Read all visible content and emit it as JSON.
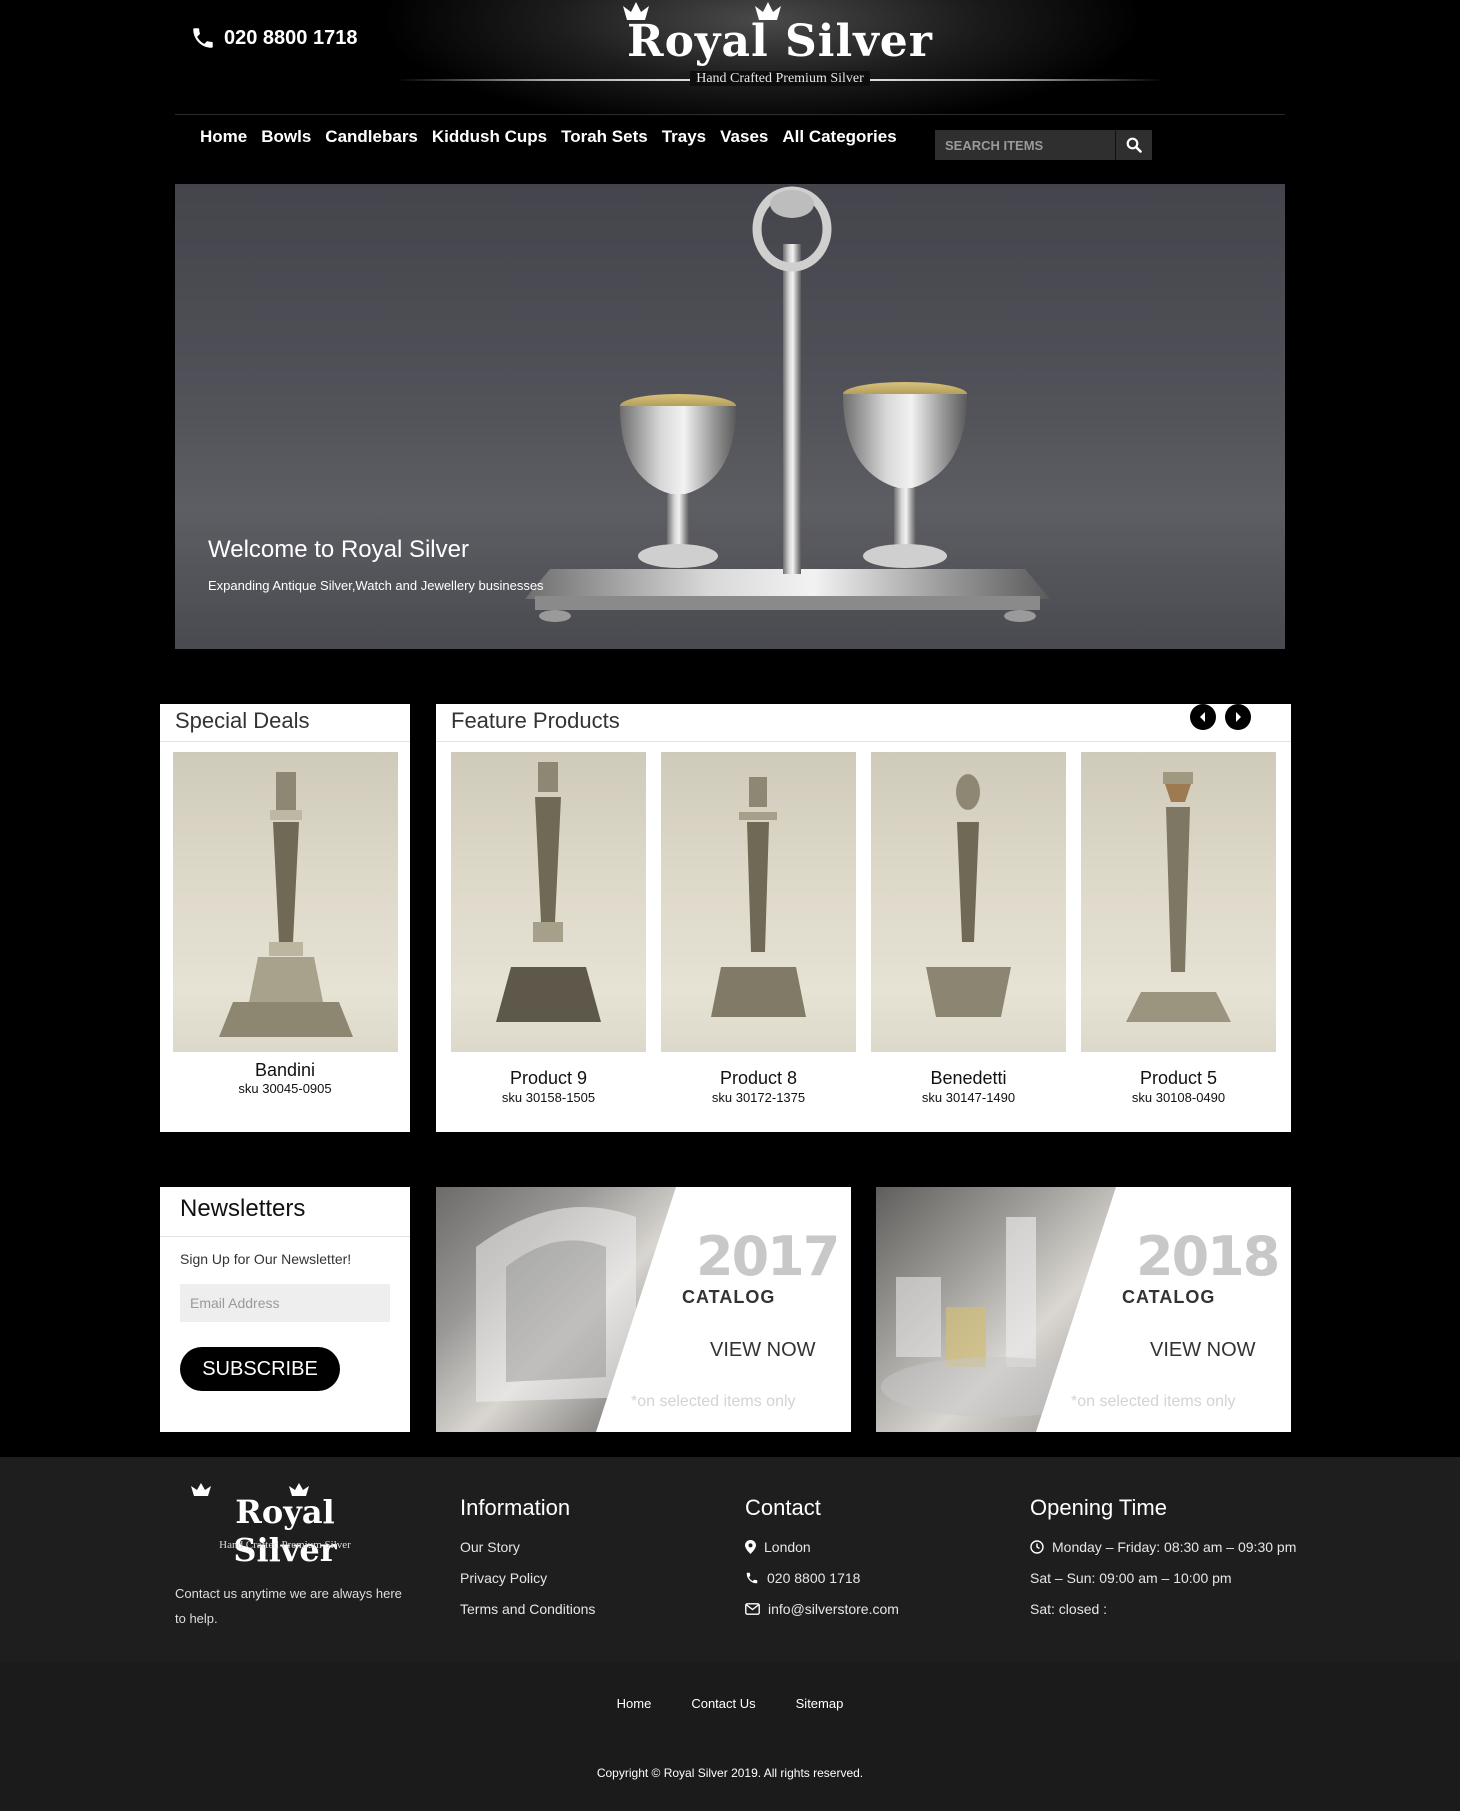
{
  "header": {
    "phone": "020 8800 1718",
    "logo_title": "Royal Silver",
    "logo_subtitle": "Hand Crafted Premium Silver"
  },
  "nav": {
    "items": [
      "Home",
      "Bowls",
      "Candlebars",
      "Kiddush Cups",
      "Torah Sets",
      "Trays",
      "Vases",
      "All Categories"
    ]
  },
  "search": {
    "placeholder": "SEARCH ITEMS"
  },
  "hero": {
    "title": "Welcome to Royal Silver",
    "subtitle": "Expanding Antique Silver,Watch and Jewellery businesses"
  },
  "special_deals": {
    "title": "Special Deals",
    "product": {
      "name": "Bandini",
      "sku": "sku 30045-0905"
    }
  },
  "featured": {
    "title": "Feature Products",
    "products": [
      {
        "name": "Product 9",
        "sku": "sku 30158-1505"
      },
      {
        "name": "Product 8",
        "sku": "sku 30172-1375"
      },
      {
        "name": "Benedetti",
        "sku": "sku 30147-1490"
      },
      {
        "name": "Product 5",
        "sku": "sku 30108-0490"
      }
    ]
  },
  "newsletter": {
    "title": "Newsletters",
    "text": "Sign Up for Our Newsletter!",
    "email_placeholder": "Email Address",
    "button": "SUBSCRIBE"
  },
  "catalogs": [
    {
      "year": "2017",
      "label": "CATALOG",
      "action": "VIEW NOW",
      "note": "*on selected items only"
    },
    {
      "year": "2018",
      "label": "CATALOG",
      "action": "VIEW NOW",
      "note": "*on selected items only"
    }
  ],
  "footer": {
    "logo_title": "Royal Silver",
    "logo_subtitle": "Hand Crafted Premium Silver",
    "about": "Contact us anytime we are always here to help.",
    "information": {
      "title": "Information",
      "links": [
        "Our Story",
        "Privacy Policy",
        "Terms and Conditions"
      ]
    },
    "contact": {
      "title": "Contact",
      "location": "London",
      "phone": "020 8800 1718",
      "email": "info@silverstore.com"
    },
    "opening": {
      "title": "Opening Time",
      "lines": [
        "Monday – Friday: 08:30 am – 09:30 pm",
        "Sat – Sun: 09:00 am – 10:00 pm",
        "Sat: closed :"
      ]
    },
    "bottom_links": [
      "Home",
      "Contact Us",
      "Sitemap"
    ],
    "copyright": "Copyright © Royal Silver 2019. All rights reserved."
  }
}
